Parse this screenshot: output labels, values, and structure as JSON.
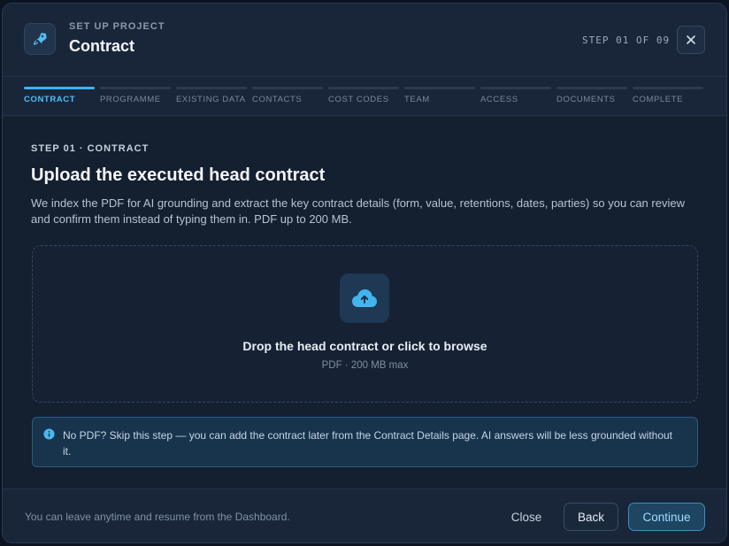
{
  "header": {
    "eyebrow": "SET UP PROJECT",
    "title": "Contract",
    "step_indicator": "STEP 01 OF 09",
    "close_glyph": "✕"
  },
  "stepper": {
    "active_index": 0,
    "steps": [
      {
        "label": "CONTRACT"
      },
      {
        "label": "PROGRAMME"
      },
      {
        "label": "EXISTING DATA"
      },
      {
        "label": "CONTACTS"
      },
      {
        "label": "COST CODES"
      },
      {
        "label": "TEAM"
      },
      {
        "label": "ACCESS"
      },
      {
        "label": "DOCUMENTS"
      },
      {
        "label": "COMPLETE"
      }
    ]
  },
  "content": {
    "eyebrow": "STEP 01 · CONTRACT",
    "heading": "Upload the executed head contract",
    "description": "We index the PDF for AI grounding and extract the key contract details (form, value, retentions, dates, parties) so you can review and confirm them instead of typing them in. PDF up to 200 MB.",
    "dropzone": {
      "title": "Drop the head contract or click to browse",
      "subtitle": "PDF · 200 MB max",
      "icon": "cloud-upload-icon"
    },
    "info": {
      "icon": "info-icon",
      "text": "No PDF? Skip this step — you can add the contract later from the Contract Details page. AI answers will be less grounded without it."
    }
  },
  "footer": {
    "note": "You can leave anytime and resume from the Dashboard.",
    "close_label": "Close",
    "back_label": "Back",
    "continue_label": "Continue"
  },
  "colors": {
    "accent": "#38b6f0",
    "background": "#162233",
    "info_border": "#2b5c80"
  }
}
